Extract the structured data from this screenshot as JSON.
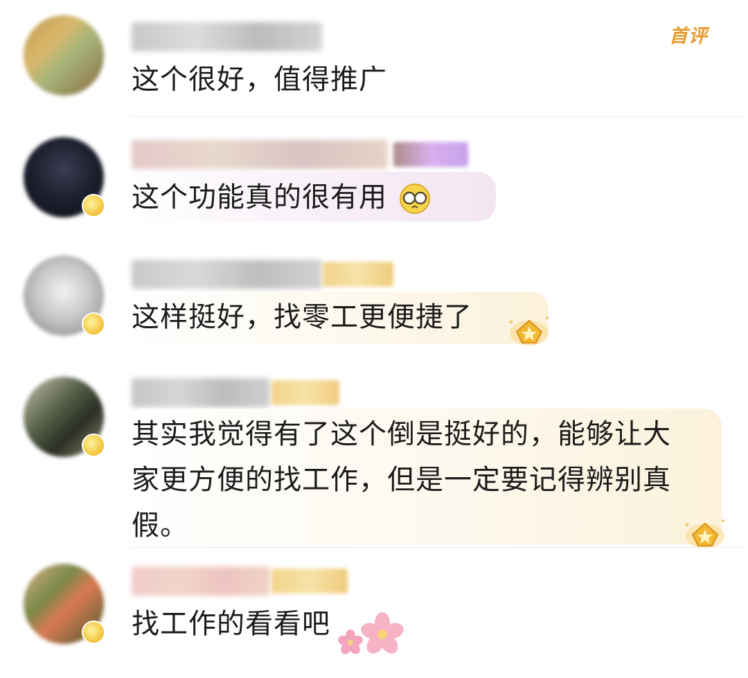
{
  "comments": [
    {
      "username": "",
      "text": "这个很好，值得推广",
      "badge": "首评",
      "avatar_colors": [
        "#c9a15a",
        "#a8ba7c",
        "#6c6c48",
        "#d9b26a"
      ]
    },
    {
      "username": "",
      "text": "这个功能真的很有用",
      "avatar_colors": [
        "#1d1f2e",
        "#3b3d52",
        "#0e0f17",
        "#6a6b80"
      ],
      "emoji": "glasses-face-icon"
    },
    {
      "username": "",
      "text": "这样挺好，找零工更便捷了",
      "avatar_colors": [
        "#d6d6d6",
        "#9a9a9a",
        "#f0f0f0",
        "#7c7c7c"
      ],
      "decoration": "golden-crown-badge-icon"
    },
    {
      "username": "",
      "text": "其实我觉得有了这个倒是挺好的，能够让大\n家更方便的找工作，但是一定要记得辨别真\n假。",
      "avatar_colors": [
        "#58624a",
        "#c9c3b0",
        "#2b2f24",
        "#8d8a70"
      ],
      "decoration": "golden-crown-badge-icon"
    },
    {
      "username": "",
      "text": "找工作的看看吧",
      "avatar_colors": [
        "#7a8a4a",
        "#d97a52",
        "#4a5a2c",
        "#e0b08a"
      ],
      "decoration": "pink-flowers-icon"
    }
  ],
  "colors": {
    "accent_orange": "#e89a2c",
    "text": "#1b1b1b",
    "divider": "#ececec",
    "bubble_purple": "#f4ecf6",
    "bubble_yellow": "#fdf6e6"
  }
}
